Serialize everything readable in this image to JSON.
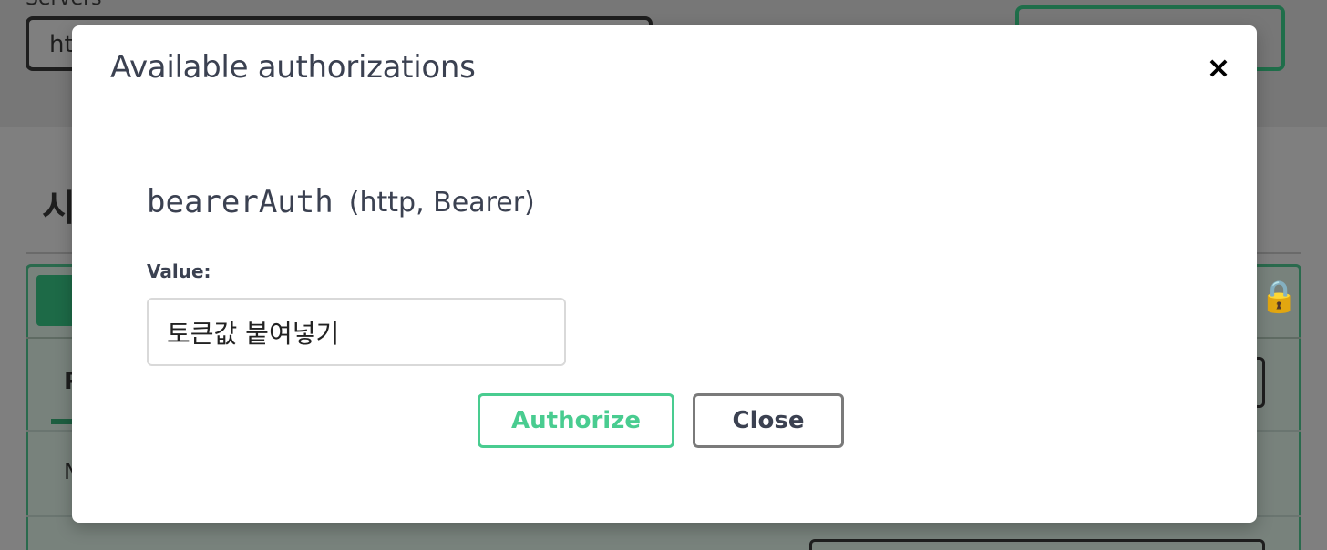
{
  "background": {
    "servers_label": "Servers",
    "servers_value": "ht",
    "section_title": "시",
    "tab_letter": "P",
    "row_letter": "N"
  },
  "modal": {
    "title": "Available authorizations",
    "close_icon": "×",
    "scheme": {
      "name": "bearerAuth",
      "type": "(http, Bearer)"
    },
    "value_label": "Value:",
    "value_input": {
      "value": "토큰값 붙여넣기"
    },
    "buttons": {
      "authorize": "Authorize",
      "close": "Close"
    }
  },
  "colors": {
    "authorize_accent": "#49cc90",
    "close_border": "#7a7a7a",
    "text": "#3b4151"
  }
}
